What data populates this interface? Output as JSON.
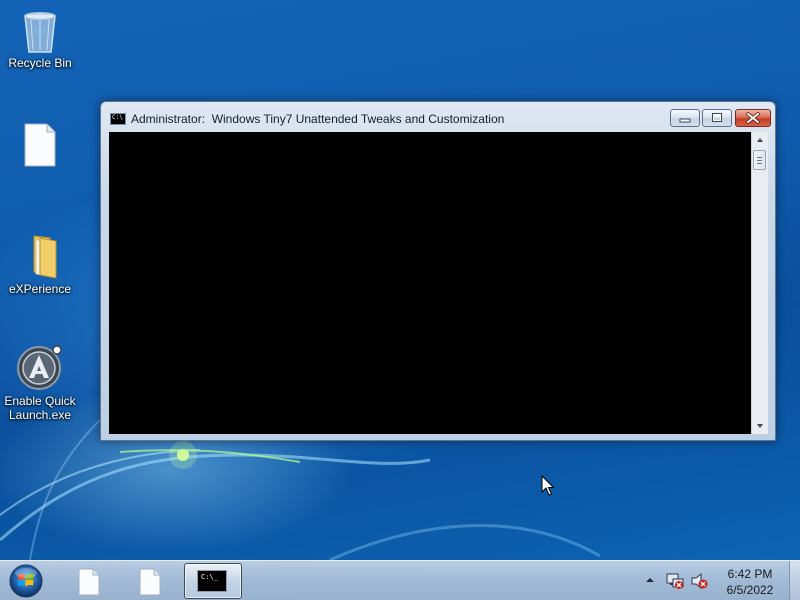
{
  "desktop": {
    "icons": [
      {
        "label": "Recycle Bin",
        "icon": "recycle-bin-icon"
      },
      {
        "label": "",
        "icon": "document-icon"
      },
      {
        "label": "eXPerience",
        "icon": "folder-icon"
      },
      {
        "label": "Enable Quick Launch.exe",
        "icon": "app-a-icon"
      }
    ]
  },
  "window": {
    "title": "Administrator:  Windows Tiny7 Unattended Tweaks and Customization",
    "icon": "cmd-icon",
    "icon_text": "C:\\",
    "console_text": ""
  },
  "taskbar": {
    "start": "windows-start-orb",
    "buttons": [
      {
        "icon": "document-icon",
        "active": false
      },
      {
        "icon": "document-icon",
        "active": false
      },
      {
        "icon": "cmd-icon",
        "active": true,
        "icon_text": "C:\\_"
      }
    ],
    "tray": {
      "icons": [
        "show-hidden-icons-chevron",
        "network-warning-icon",
        "volume-muted-icon"
      ],
      "time": "6:42 PM",
      "date": "6/5/2022"
    }
  },
  "colors": {
    "desktop_blue": "#0f5cae",
    "console_background": "#000000",
    "close_button_red": "#c43f22"
  }
}
